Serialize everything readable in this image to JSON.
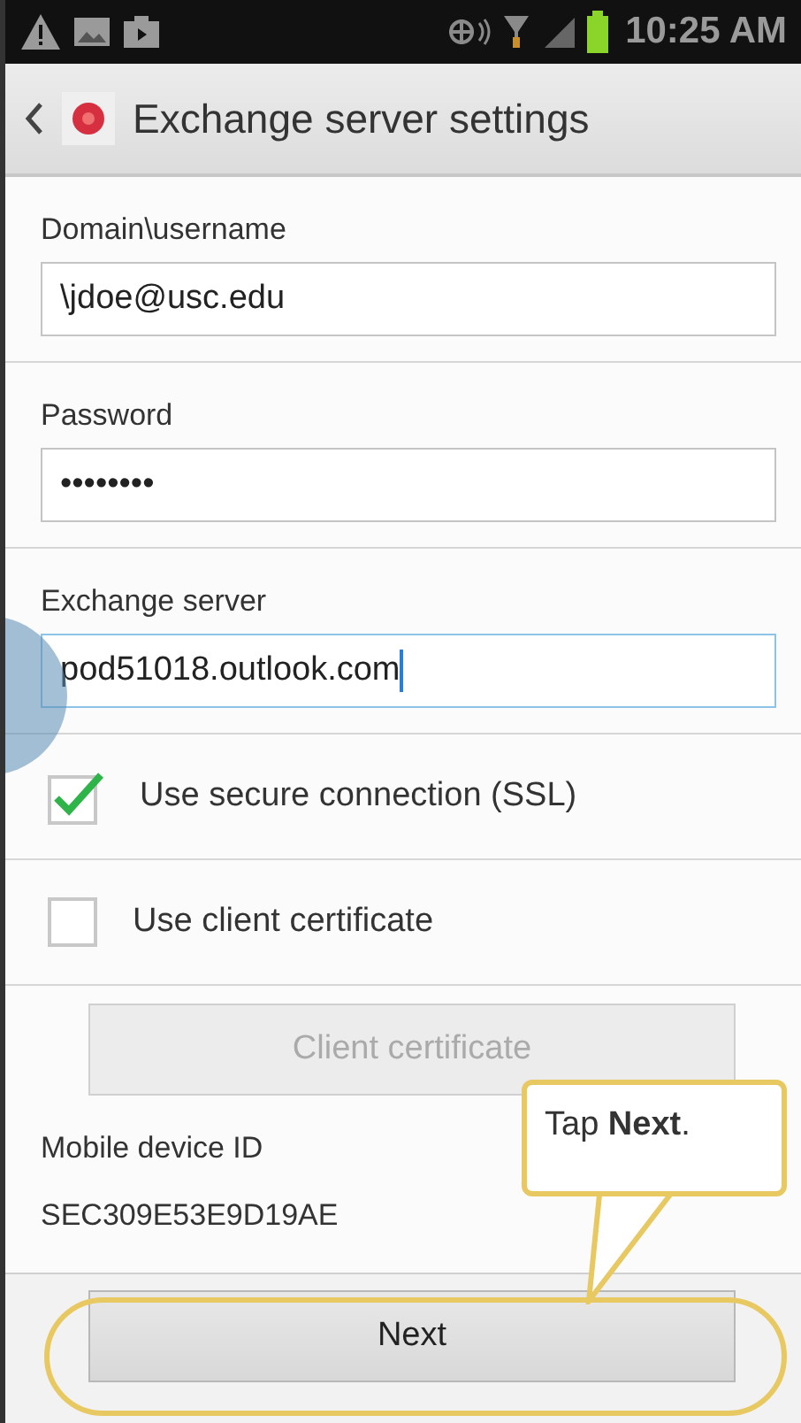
{
  "status_bar": {
    "time": "10:25 AM"
  },
  "header": {
    "title": "Exchange server settings"
  },
  "fields": [
    {
      "label": "Domain\\username",
      "value": "\\jdoe@usc.edu",
      "focused": false
    },
    {
      "label": "Password",
      "value": "••••••••",
      "focused": false
    },
    {
      "label": "Exchange server",
      "value": "pod51018.outlook.com",
      "focused": true
    }
  ],
  "options": [
    {
      "label": "Use secure connection (SSL)",
      "checked": true
    },
    {
      "label": "Use client certificate",
      "checked": false
    }
  ],
  "client_certificate_button": {
    "label": "Client certificate",
    "disabled": true
  },
  "device_id": {
    "label": "Mobile device ID",
    "value": "SEC309E53E9D19AE"
  },
  "next_button": {
    "label": "Next"
  },
  "callout": {
    "text": "Tap **Next**."
  }
}
